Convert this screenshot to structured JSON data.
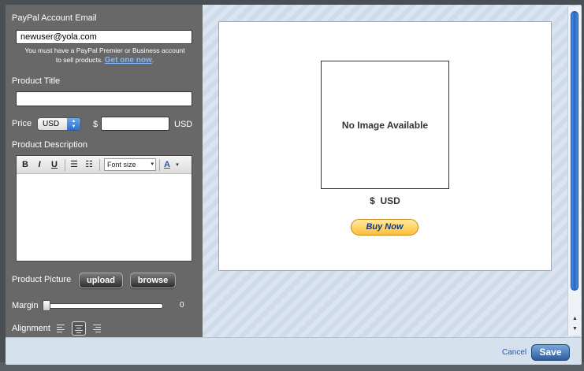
{
  "form": {
    "email_label": "PayPal Account Email",
    "email_value": "newuser@yola.com",
    "note_text": "You must have a PayPal Premier or Business account to sell products.",
    "note_link": "Get one now",
    "note_end": ".",
    "title_label": "Product Title",
    "title_value": "",
    "price_label": "Price",
    "currency_selected": "USD",
    "currency_symbol": "$",
    "price_value": "",
    "price_unit": "USD",
    "description_label": "Product Description",
    "toolbar": {
      "bold": "B",
      "italic": "I",
      "underline": "U",
      "font_size": "Font size",
      "font_color": "A"
    },
    "picture_label": "Product Picture",
    "upload_label": "upload",
    "browse_label": "browse",
    "margin_label": "Margin",
    "margin_value": "0",
    "margin_fraction": 0,
    "alignment_label": "Alignment",
    "alignment_selected": "center"
  },
  "preview": {
    "no_image": "No Image Available",
    "price_symbol": "$",
    "price_unit": "USD",
    "buy_now": "Buy Now"
  },
  "footer": {
    "cancel_label": "Cancel",
    "save_label": "Save"
  },
  "colors": {
    "panel": "#686868",
    "preview_bg": "#dbe5f1",
    "accent": "#2d5e9e",
    "buy_button": "#ffbe3a"
  }
}
